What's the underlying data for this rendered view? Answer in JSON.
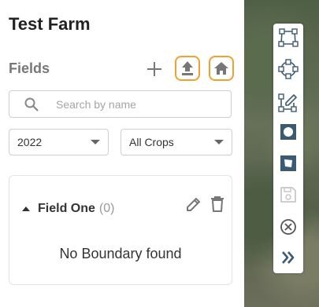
{
  "farm": {
    "title": "Test Farm"
  },
  "fields_section": {
    "label": "Fields",
    "add_icon": "plus-icon",
    "upload_icon": "upload-icon",
    "home_icon": "home-icon"
  },
  "search": {
    "placeholder": "Search by name",
    "value": "",
    "icon": "search-icon"
  },
  "filters": {
    "year": {
      "selected": "2022"
    },
    "crops": {
      "selected": "All Crops"
    }
  },
  "field_card": {
    "name": "Field One",
    "count": "(0)",
    "message": "No Boundary found",
    "edit_icon": "pencil-icon",
    "delete_icon": "trash-icon"
  },
  "map_tools": [
    {
      "icon": "draw-polygon-icon"
    },
    {
      "icon": "draw-circle-icon"
    },
    {
      "icon": "edit-shape-icon"
    },
    {
      "icon": "cut-circle-icon"
    },
    {
      "icon": "cut-polygon-icon"
    },
    {
      "icon": "save-icon",
      "disabled": true
    },
    {
      "icon": "cancel-icon"
    },
    {
      "icon": "collapse-double-chevron-icon"
    }
  ],
  "colors": {
    "accent": "#f0a12e",
    "icon_gray": "#777777",
    "tool_icon": "#3d5a73",
    "text_dark": "#222222"
  }
}
